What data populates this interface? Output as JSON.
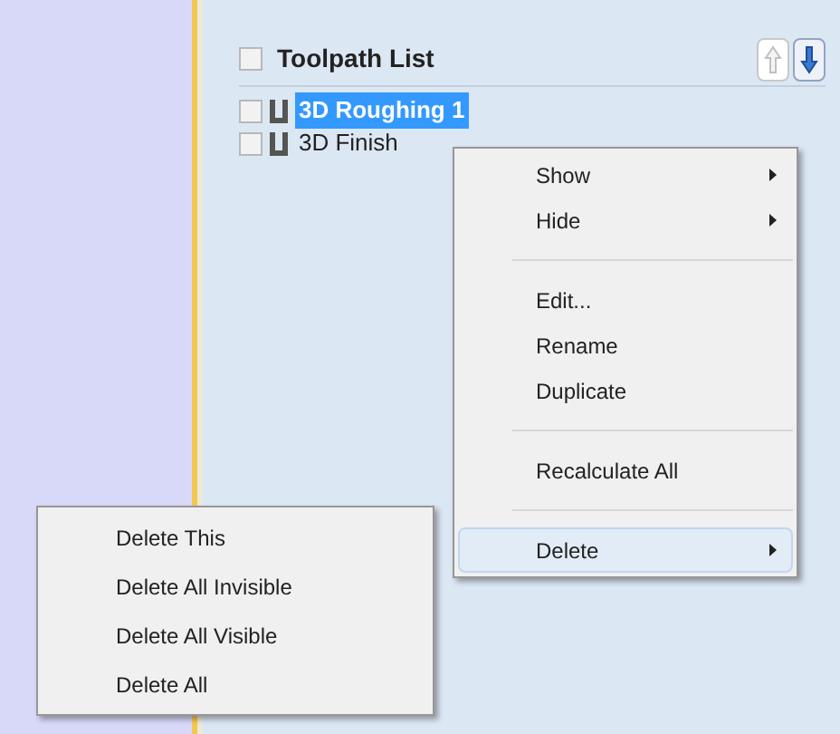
{
  "panel": {
    "title": "Toolpath List",
    "checked": false
  },
  "toolpaths": [
    {
      "name": "3D Roughing 1",
      "checked": false,
      "selected": true
    },
    {
      "name": "3D Finish",
      "checked": false,
      "selected": false
    }
  ],
  "context_menu": {
    "items": [
      {
        "label": "Show",
        "kind": "submenu",
        "selected": false
      },
      {
        "label": "Hide",
        "kind": "submenu",
        "selected": false
      },
      {
        "kind": "separator"
      },
      {
        "label": "Edit...",
        "kind": "item",
        "selected": false
      },
      {
        "label": "Rename",
        "kind": "item",
        "selected": false
      },
      {
        "label": "Duplicate",
        "kind": "item",
        "selected": false
      },
      {
        "kind": "separator"
      },
      {
        "label": "Recalculate All",
        "kind": "item",
        "selected": false
      },
      {
        "kind": "separator"
      },
      {
        "label": "Delete",
        "kind": "submenu",
        "selected": true
      }
    ]
  },
  "submenu": {
    "items": [
      {
        "label": "Delete This"
      },
      {
        "label": "Delete All Invisible"
      },
      {
        "label": "Delete All Visible"
      },
      {
        "label": "Delete All"
      }
    ]
  }
}
